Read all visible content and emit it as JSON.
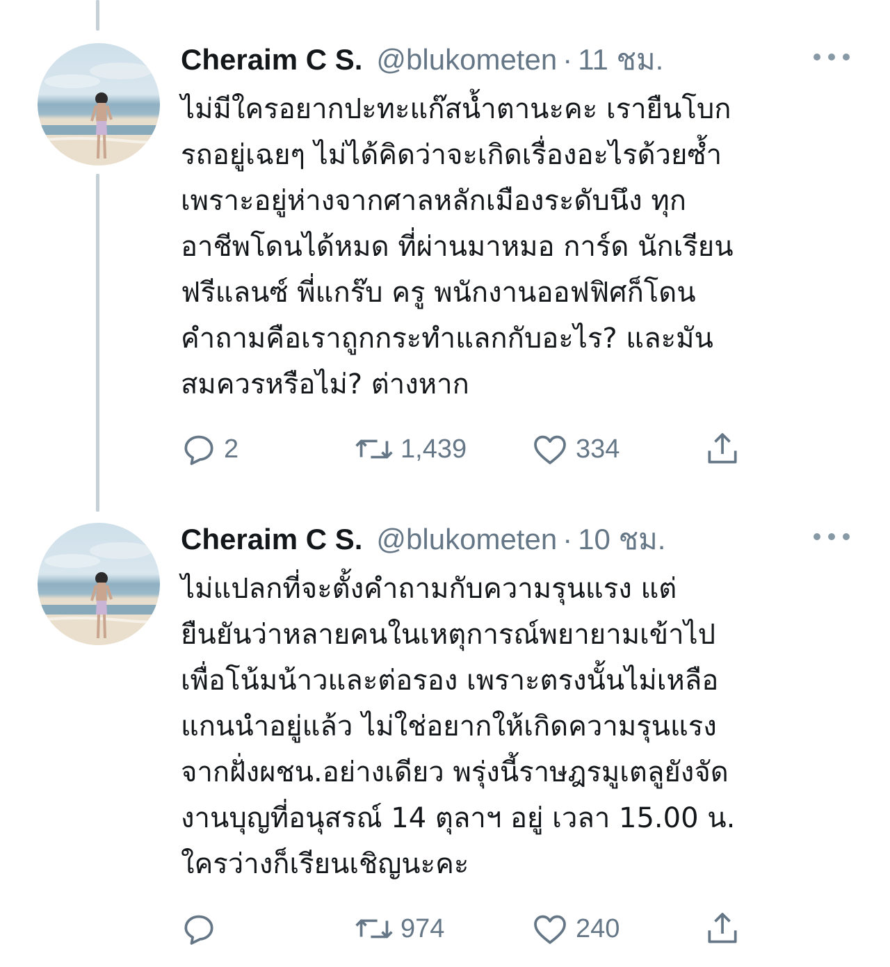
{
  "tweets": [
    {
      "display_name": "Cheraim C S.",
      "handle": "@blukometen",
      "separator": "·",
      "time": "11 ชม.",
      "lines": [
        "ไม่มีใครอยากปะทะแก๊สน้ำตานะคะ เรายืนโบก",
        "รถอยู่เฉยๆ ไม่ได้คิดว่าจะเกิดเรื่องอะไรด้วยซ้ำ",
        "เพราะอยู่ห่างจากศาลหลักเมืองระดับนึง ทุก",
        "อาชีพโดนได้หมด ที่ผ่านมาหมอ การ์ด นักเรียน",
        "ฟรีแลนซ์ พี่แกร๊บ ครู พนักงานออฟฟิศก็โดน",
        "คำถามคือเราถูกกระทำแลกกับอะไร? และมัน",
        "สมควรหรือไม่? ต่างหาก"
      ],
      "replies": "2",
      "retweets": "1,439",
      "likes": "334"
    },
    {
      "display_name": "Cheraim C S.",
      "handle": "@blukometen",
      "separator": "·",
      "time": "10 ชม.",
      "lines": [
        "ไม่แปลกที่จะตั้งคำถามกับความรุนแรง แต่",
        "ยืนยันว่าหลายคนในเหตุการณ์พยายามเข้าไป",
        "เพื่อโน้มน้าวและต่อรอง เพราะตรงนั้นไม่เหลือ",
        "แกนนำอยู่แล้ว ไม่ใช่อยากให้เกิดความรุนแรง",
        "จากฝั่งผชน.อย่างเดียว พรุ่งนี้ราษฎรมูเตลูยังจัด",
        "งานบุญที่อนุสรณ์ 14 ตุลาฯ อยู่ เวลา 15.00 น.",
        "ใครว่างก็เรียนเชิญนะคะ"
      ],
      "replies": "",
      "retweets": "974",
      "likes": "240"
    }
  ],
  "colors": {
    "text": "#14171a",
    "secondary": "#657786",
    "thread_line": "#c4cfd6"
  },
  "icons": [
    "reply-icon",
    "retweet-icon",
    "like-icon",
    "share-icon",
    "more-icon"
  ]
}
